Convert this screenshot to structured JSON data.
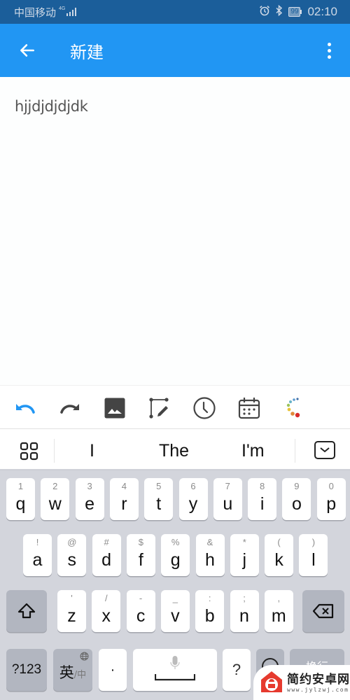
{
  "status_bar": {
    "carrier": "中国移动",
    "network": "4G",
    "battery": "99",
    "time": "02:10",
    "icons": [
      "signal-icon",
      "alarm-icon",
      "bluetooth-icon",
      "battery-icon"
    ]
  },
  "app_bar": {
    "back_icon": "arrow-left-icon",
    "title": "新建",
    "more_icon": "more-vert-icon"
  },
  "editor": {
    "text": "hjjdjdjdjdk"
  },
  "toolbar": {
    "items": [
      {
        "name": "undo",
        "icon": "undo-icon",
        "color": "#2196f3"
      },
      {
        "name": "redo",
        "icon": "redo-icon",
        "color": "#444444"
      },
      {
        "name": "insert-image",
        "icon": "image-icon",
        "color": "#444444"
      },
      {
        "name": "draw",
        "icon": "draw-icon",
        "color": "#444444"
      },
      {
        "name": "reminder",
        "icon": "clock-icon",
        "color": "#444444"
      },
      {
        "name": "calendar",
        "icon": "calendar-icon",
        "color": "#444444"
      },
      {
        "name": "color",
        "icon": "color-palette-icon",
        "color": "#e53935"
      }
    ]
  },
  "suggestions": {
    "words": [
      "I",
      "The",
      "I'm"
    ]
  },
  "keyboard": {
    "row1": [
      {
        "k": "q",
        "a": "1"
      },
      {
        "k": "w",
        "a": "2"
      },
      {
        "k": "e",
        "a": "3"
      },
      {
        "k": "r",
        "a": "4"
      },
      {
        "k": "t",
        "a": "5"
      },
      {
        "k": "y",
        "a": "6"
      },
      {
        "k": "u",
        "a": "7"
      },
      {
        "k": "i",
        "a": "8"
      },
      {
        "k": "o",
        "a": "9"
      },
      {
        "k": "p",
        "a": "0"
      }
    ],
    "row2": [
      {
        "k": "a",
        "a": "!"
      },
      {
        "k": "s",
        "a": "@"
      },
      {
        "k": "d",
        "a": "#"
      },
      {
        "k": "f",
        "a": "$"
      },
      {
        "k": "g",
        "a": "%"
      },
      {
        "k": "h",
        "a": "&"
      },
      {
        "k": "j",
        "a": "*"
      },
      {
        "k": "k",
        "a": "("
      },
      {
        "k": "l",
        "a": ")"
      }
    ],
    "row3": [
      {
        "k": "z",
        "a": "'"
      },
      {
        "k": "x",
        "a": "/"
      },
      {
        "k": "c",
        "a": "-"
      },
      {
        "k": "v",
        "a": "_"
      },
      {
        "k": "b",
        "a": ":"
      },
      {
        "k": "n",
        "a": ";"
      },
      {
        "k": "m",
        "a": ","
      }
    ],
    "symbols_label": "?123",
    "lang_label": "英",
    "lang_alt": "/中",
    "dot_label": "·",
    "question_label": "?",
    "return_label": "换行"
  },
  "watermark": {
    "name": "简约安卓网",
    "url": "www.jylzwj.com"
  }
}
